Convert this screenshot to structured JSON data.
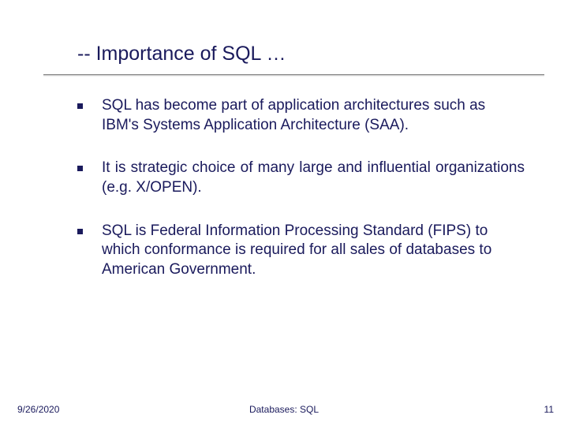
{
  "title": "-- Importance of SQL …",
  "bullets": [
    {
      "text": "SQL has become part of application architectures such as IBM's Systems Application Architecture (SAA).",
      "justify": false
    },
    {
      "text": "It is strategic choice of many large and influential organizations (e.g. X/OPEN).",
      "justify": true
    },
    {
      "text": "SQL is Federal Information Processing Standard (FIPS) to which conformance is required for all sales of databases to American Government.",
      "justify": false
    }
  ],
  "footer": {
    "date": "9/26/2020",
    "center": "Databases: SQL",
    "page": "11"
  }
}
